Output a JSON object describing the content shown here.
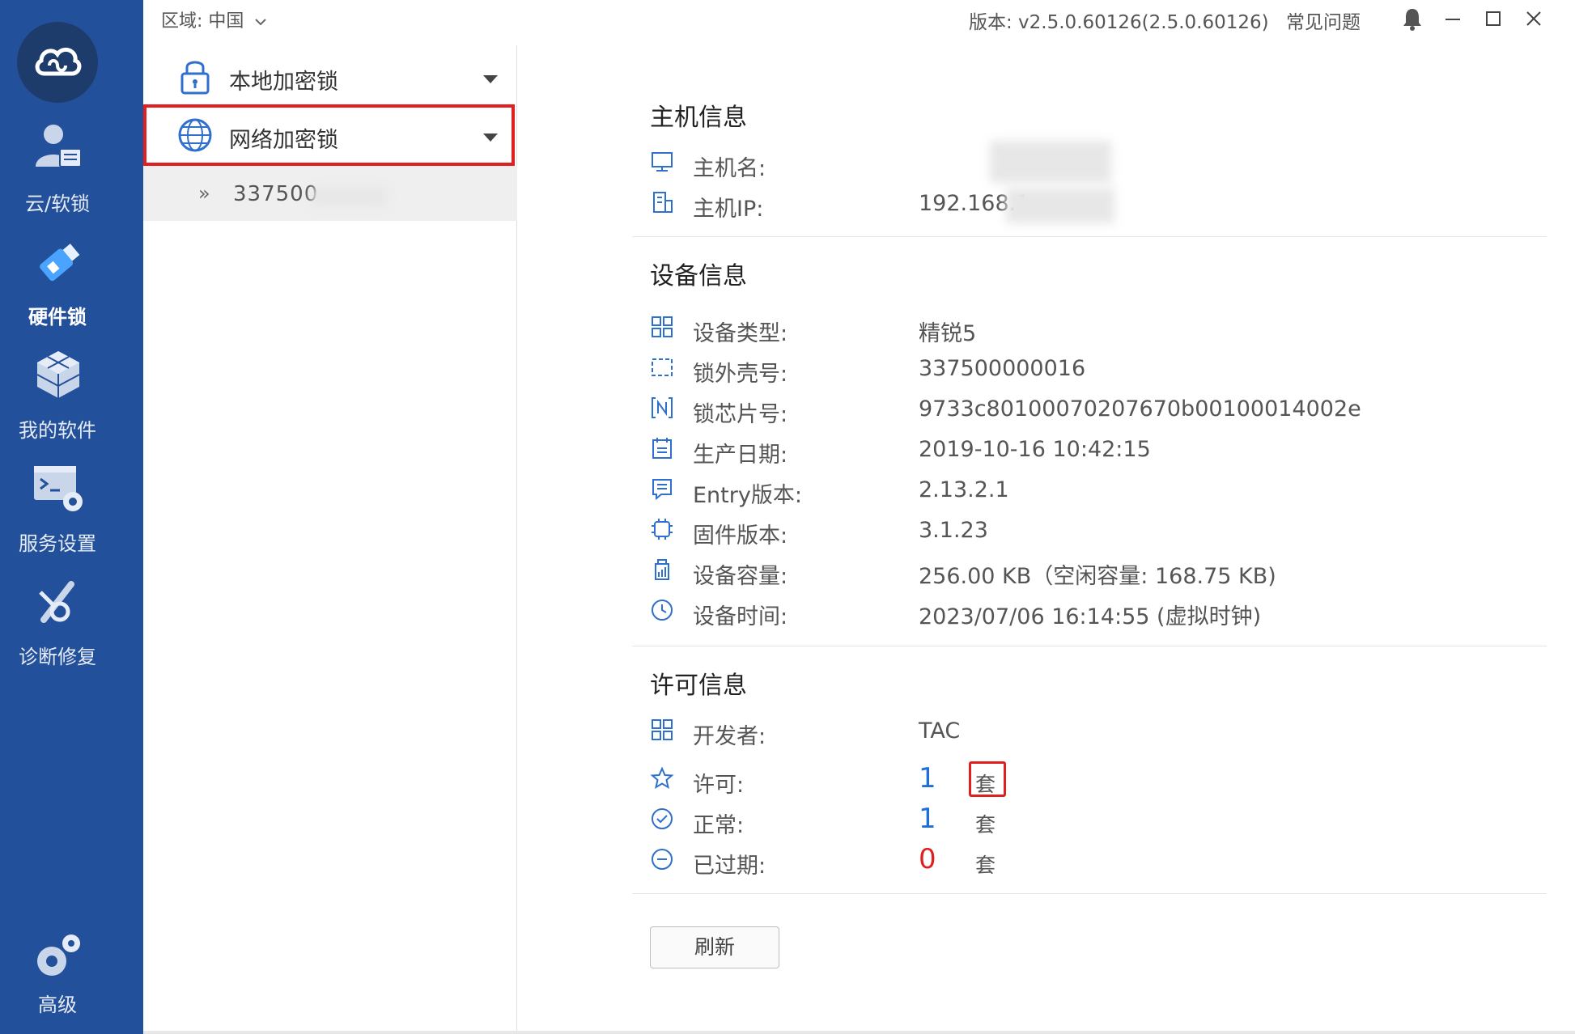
{
  "colors": {
    "sidebar_bg": "#23509a",
    "accent_blue": "#1e6fd9",
    "expired_red": "#e02020",
    "highlight_border": "#e02020"
  },
  "nav": {
    "items": [
      {
        "label": "云/软锁",
        "icon": "user-cloud-icon"
      },
      {
        "label": "硬件锁",
        "icon": "usb-key-icon",
        "active": true
      },
      {
        "label": "我的软件",
        "icon": "cubes-icon"
      },
      {
        "label": "服务设置",
        "icon": "server-gear-icon"
      },
      {
        "label": "诊断修复",
        "icon": "wrench-icon"
      },
      {
        "label": "高级",
        "icon": "gears-icon"
      }
    ]
  },
  "topbar": {
    "region_label": "区域:",
    "region_value": "中国",
    "version": "版本: v2.5.0.60126(2.5.0.60126)",
    "faq": "常见问题"
  },
  "tree": {
    "local_lock": "本地加密锁",
    "network_lock": "网络加密锁",
    "child_prefix": "337500"
  },
  "host": {
    "title": "主机信息",
    "hostname_label": "主机名:",
    "ip_label": "主机IP:",
    "ip_value": "192.168.1"
  },
  "device": {
    "title": "设备信息",
    "rows": [
      {
        "icon": "grid-icon",
        "label": "设备类型:",
        "value": "精锐5"
      },
      {
        "icon": "dashed-frame-icon",
        "label": "锁外壳号:",
        "value": "337500000016"
      },
      {
        "icon": "chip-n-icon",
        "label": "锁芯片号:",
        "value": "9733c80100070207670b00100014002e"
      },
      {
        "icon": "calendar-icon",
        "label": "生产日期:",
        "value": "2019-10-16 10:42:15"
      },
      {
        "icon": "doc-icon",
        "label": "Entry版本:",
        "value": "2.13.2.1"
      },
      {
        "icon": "cpu-icon",
        "label": "固件版本:",
        "value": "3.1.23"
      },
      {
        "icon": "storage-icon",
        "label": "设备容量:",
        "value": "256.00 KB（空闲容量: 168.75 KB)"
      },
      {
        "icon": "clock-icon",
        "label": "设备时间:",
        "value": "2023/07/06 16:14:55 (虚拟时钟)"
      }
    ]
  },
  "license": {
    "title": "许可信息",
    "developer_label": "开发者:",
    "developer_value": "TAC",
    "license_label": "许可:",
    "license_count": "1",
    "normal_label": "正常:",
    "normal_count": "1",
    "expired_label": "已过期:",
    "expired_count": "0",
    "unit": "套"
  },
  "actions": {
    "refresh": "刷新"
  }
}
